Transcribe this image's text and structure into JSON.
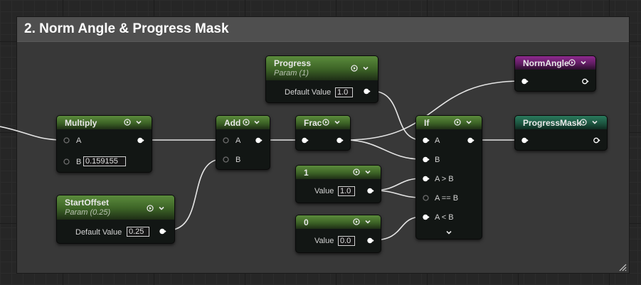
{
  "comment": {
    "title": "2. Norm Angle & Progress Mask"
  },
  "nodes": {
    "multiply": {
      "title": "Multiply",
      "pin_a": "A",
      "pin_b": "B",
      "b_value": "0.159155"
    },
    "add": {
      "title": "Add",
      "pin_a": "A",
      "pin_b": "B"
    },
    "frac": {
      "title": "Frac"
    },
    "progress": {
      "title": "Progress",
      "subtitle": "Param (1)",
      "field_label": "Default Value",
      "value": "1.0"
    },
    "start_offset": {
      "title": "StartOffset",
      "subtitle": "Param (0.25)",
      "field_label": "Default Value",
      "value": "0.25"
    },
    "const_one": {
      "title": "1",
      "field_label": "Value",
      "value": "1.0"
    },
    "const_zero": {
      "title": "0",
      "field_label": "Value",
      "value": "0.0"
    },
    "if_node": {
      "title": "If",
      "pin_a": "A",
      "pin_b": "B",
      "pin_agtb": "A > B",
      "pin_aeqb": "A == B",
      "pin_altb": "A < B"
    },
    "norm_angle": {
      "title": "NormAngle"
    },
    "progress_mask": {
      "title": "ProgressMask"
    }
  },
  "icons": {
    "preview": "play-circle-icon",
    "collapse": "chevron-down-icon",
    "input_pin": "input-pin-icon",
    "output_pin": "output-pin-icon",
    "advanced": "expand-chevron-icon",
    "resize": "resize-grip-icon"
  },
  "colors": {
    "param_header": "#4c7a32",
    "named_reroute_purple": "#7a257b",
    "named_reroute_teal": "#226a50",
    "node_body": "#121614",
    "wire": "#e6e6e6",
    "comment_header": "#4f4f4f"
  }
}
